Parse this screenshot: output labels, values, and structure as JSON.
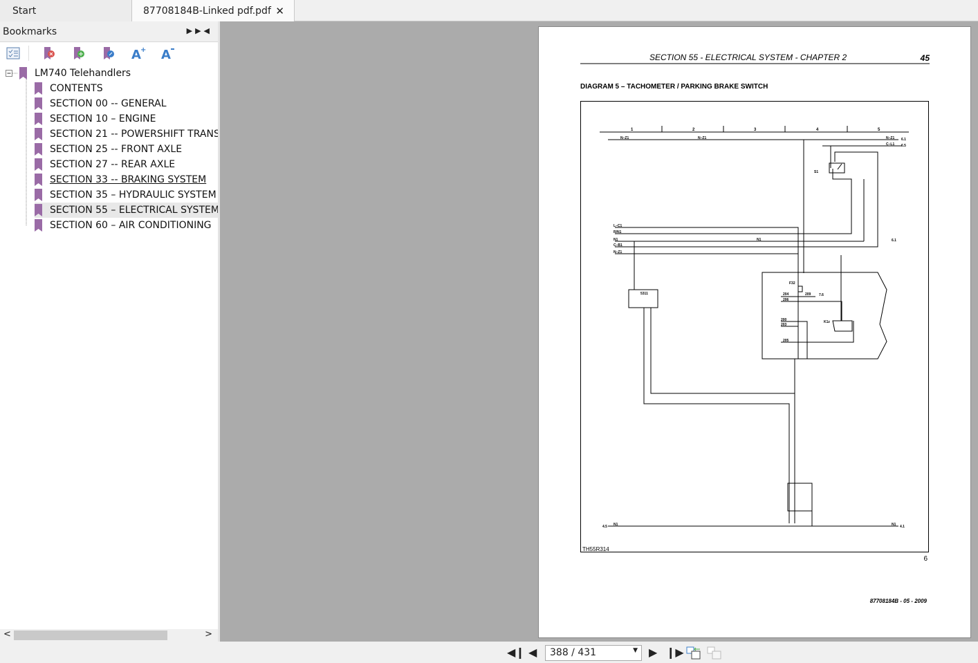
{
  "tabs": [
    {
      "label": "Start"
    },
    {
      "label": "87708184B-Linked pdf.pdf",
      "close": "✕"
    }
  ],
  "bookmarks": {
    "title": "Bookmarks",
    "root": "LM740 Telehandlers",
    "items": [
      {
        "label": "CONTENTS"
      },
      {
        "label": "SECTION 00 -- GENERAL"
      },
      {
        "label": "SECTION 10 – ENGINE"
      },
      {
        "label": "SECTION 21 -- POWERSHIFT TRANSMISSION"
      },
      {
        "label": "SECTION 25 -- FRONT AXLE"
      },
      {
        "label": "SECTION 27 -- REAR AXLE"
      },
      {
        "label": "SECTION 33 -- BRAKING SYSTEM"
      },
      {
        "label": "SECTION 35 – HYDRAULIC SYSTEM"
      },
      {
        "label": "SECTION 55 – ELECTRICAL SYSTEM"
      },
      {
        "label": "SECTION 60 – AIR CONDITIONING"
      }
    ],
    "tools": [
      "expand-all-icon",
      "delete-bookmark-icon",
      "add-bookmark-icon",
      "goto-bookmark-icon",
      "font-increase-icon",
      "font-decrease-icon"
    ],
    "bookmark_color": "#9a6ba6"
  },
  "document": {
    "header": "SECTION 55 - ELECTRICAL SYSTEM - CHAPTER 2",
    "page_number": "45",
    "diagram_title": "DIAGRAM 5 – TACHOMETER / PARKING BRAKE SWITCH",
    "diagram_code": "TH55R314",
    "diagram_index": "6",
    "footer": "87708184B - 05 - 2009",
    "columns": [
      "1",
      "2",
      "3",
      "4",
      "5"
    ],
    "labels": [
      "N–Z1",
      "N–Z1",
      "N–Z1",
      "C–L1",
      "6.1",
      "6.5",
      "L–C1",
      "R/N1",
      "N1",
      "C–B1",
      "N–Z1",
      "N1",
      "6.1",
      "5311",
      "F32",
      "204",
      "209",
      "7.6",
      "206",
      "200",
      "203",
      "205",
      "K1z",
      "S1",
      "N1",
      "4.1",
      "4.5",
      "N1"
    ]
  },
  "footer_nav": {
    "page_field": "388 / 431",
    "buttons": [
      "first-page",
      "previous-page",
      "next-page",
      "last-page",
      "previous-view",
      "next-view"
    ]
  }
}
